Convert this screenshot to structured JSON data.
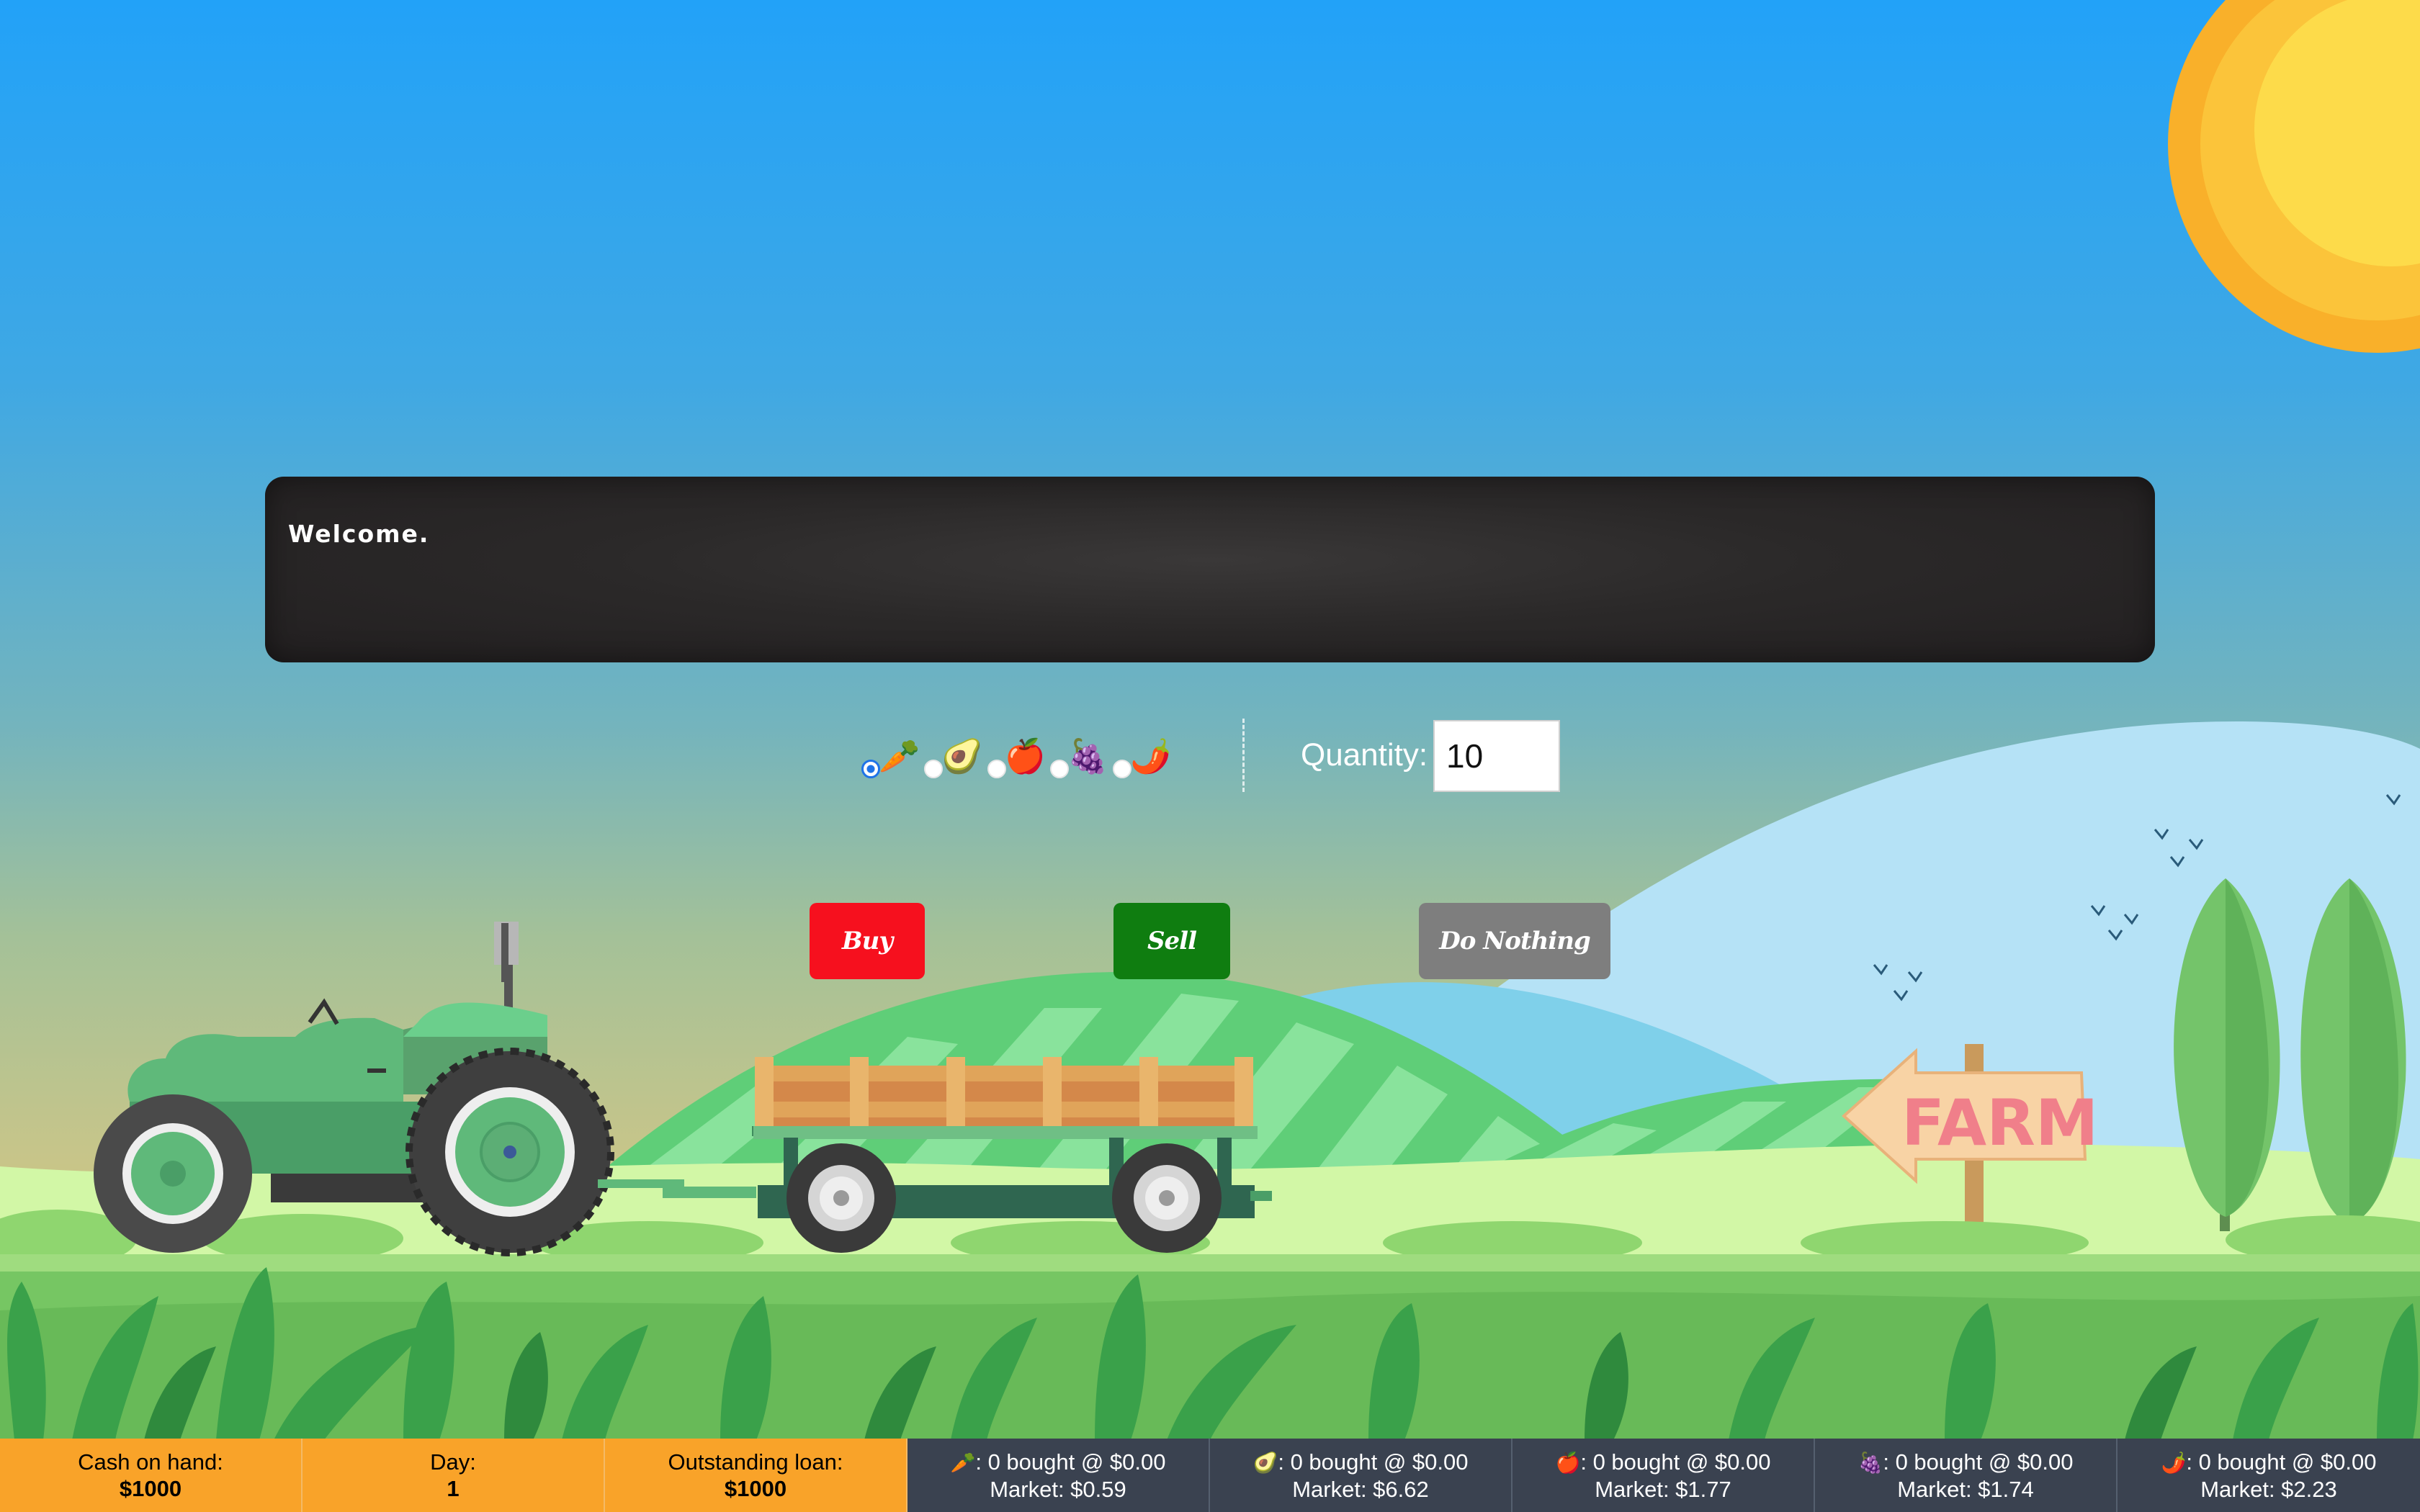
{
  "message_board": {
    "text": "Welcome."
  },
  "produce_options": [
    {
      "icon": "carrot-icon",
      "glyph": "🥕",
      "selected": true
    },
    {
      "icon": "avocado-icon",
      "glyph": "🥑",
      "selected": false
    },
    {
      "icon": "apple-icon",
      "glyph": "🍎",
      "selected": false
    },
    {
      "icon": "grapes-icon",
      "glyph": "🍇",
      "selected": false
    },
    {
      "icon": "chili-pepper-icon",
      "glyph": "🌶️",
      "selected": false
    }
  ],
  "quantity": {
    "label": "Quantity:",
    "value": "10"
  },
  "actions": {
    "buy": "Buy",
    "sell": "Sell",
    "do_nothing": "Do Nothing"
  },
  "sign": {
    "text": "FARM"
  },
  "status": {
    "cash": {
      "label": "Cash on hand:",
      "value": "$1000"
    },
    "day": {
      "label": "Day:",
      "value": "1"
    },
    "loan": {
      "label": "Outstanding loan:",
      "value": "$1000"
    }
  },
  "inventory": [
    {
      "icon": "carrot-icon",
      "glyph": "🥕",
      "bought": ": 0 bought @ $0.00",
      "market": "Market: $0.59"
    },
    {
      "icon": "avocado-icon",
      "glyph": "🥑",
      "bought": ": 0 bought @ $0.00",
      "market": "Market: $6.62"
    },
    {
      "icon": "apple-icon",
      "glyph": "🍎",
      "bought": ": 0 bought @ $0.00",
      "market": "Market: $1.77"
    },
    {
      "icon": "grapes-icon",
      "glyph": "🍇",
      "bought": ": 0 bought @ $0.00",
      "market": "Market: $1.74"
    },
    {
      "icon": "chili-pepper-icon",
      "glyph": "🌶️",
      "bought": ": 0 bought @ $0.00",
      "market": "Market: $2.23"
    }
  ],
  "colors": {
    "buy": "#f6101e",
    "sell": "#0f7d10",
    "do_nothing": "#7e7e7e",
    "statusbar_orange": "#f9a329",
    "statusbar_dark": "#3a4250"
  }
}
